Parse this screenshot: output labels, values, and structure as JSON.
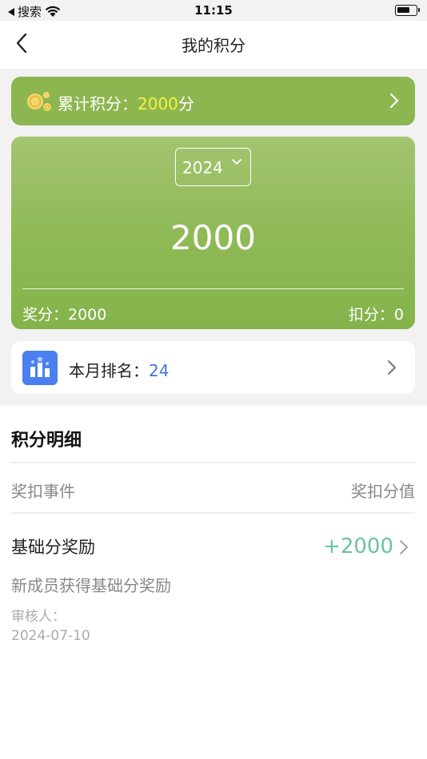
{
  "status_bar": {
    "back_app": "搜索",
    "time": "11:15"
  },
  "nav": {
    "title": "我的积分"
  },
  "total": {
    "label": "累计积分：",
    "value": "2000",
    "unit": "分"
  },
  "summary": {
    "year": "2024",
    "points": "2000",
    "reward": "奖分：2000",
    "deduct": "扣分：0"
  },
  "rank": {
    "label": "本月排名：",
    "value": "24"
  },
  "detail": {
    "title": "积分明细",
    "columns": {
      "event": "奖扣事件",
      "value": "奖扣分值"
    },
    "items": [
      {
        "title": "基础分奖励",
        "points": "+2000",
        "description": "新成员获得基础分奖励",
        "reviewer": "审核人：",
        "date": "2024-07-10"
      }
    ]
  },
  "colors": {
    "accent_green": "#8db651",
    "total_value_yellow": "#f6f23a",
    "rank_blue": "#3f74d8",
    "points_teal": "#6cc3a2"
  },
  "icons": [
    "back-arrow-icon",
    "wifi-icon",
    "battery-icon",
    "coin-icon",
    "chevron-right-icon",
    "chevron-down-icon",
    "ranking-podium-icon"
  ]
}
